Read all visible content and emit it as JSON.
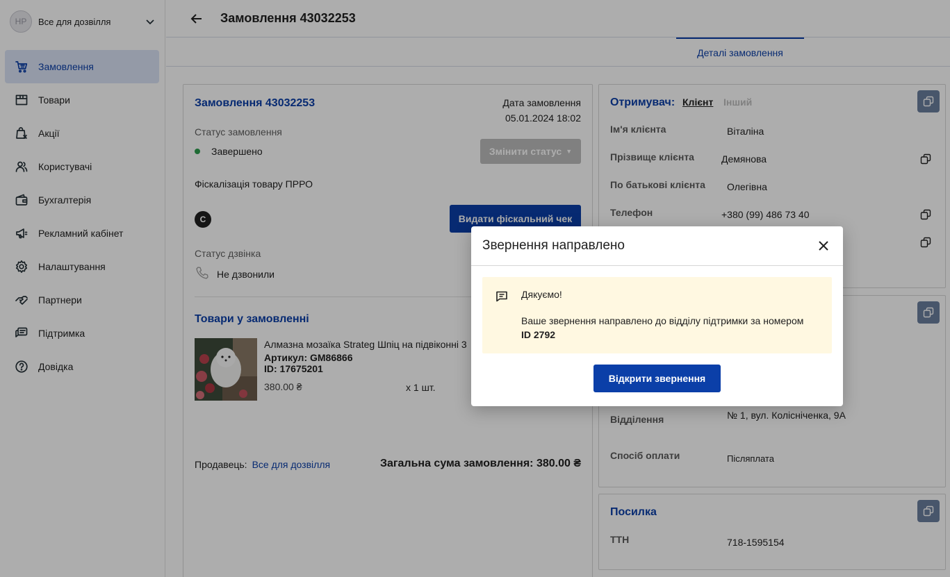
{
  "shop": {
    "avatar": "HP",
    "name": "Все для дозвілля"
  },
  "nav": [
    {
      "label": "Замовлення",
      "icon": "cart-icon"
    },
    {
      "label": "Товари",
      "icon": "box-icon"
    },
    {
      "label": "Акції",
      "icon": "promo-bag-icon"
    },
    {
      "label": "Користувачі",
      "icon": "users-icon"
    },
    {
      "label": "Бухгалтерія",
      "icon": "wallet-icon"
    },
    {
      "label": "Рекламний кабінет",
      "icon": "megaphone-icon"
    },
    {
      "label": "Налаштування",
      "icon": "gear-icon"
    },
    {
      "label": "Партнери",
      "icon": "handshake-icon"
    },
    {
      "label": "Підтримка",
      "icon": "chat-icon"
    },
    {
      "label": "Довідка",
      "icon": "help-icon"
    }
  ],
  "header": {
    "title": "Замовлення 43032253"
  },
  "tabs": {
    "active": "Деталі замовлення"
  },
  "order": {
    "title": "Замовлення 43032253",
    "date_label": "Дата замовлення",
    "date_value": "05.01.2024 18:02",
    "status_label": "Статус замовлення",
    "status_value": "Завершено",
    "change_status": "Змінити статус",
    "fiscal_label": "Фіскалізація товару ПРРО",
    "fiscal_badge": "C",
    "fiscal_button": "Видати фіскальний чек",
    "call_status_label": "Статус дзвінка",
    "call_status_value": "Не дзвонили",
    "items_title": "Товари у замовленні",
    "item": {
      "name": "Алмазна мозаїка Strateg Шпіц на підвіконні 3",
      "article": "Артикул: GM86866",
      "id": "ID: 17675201",
      "price": "380.00 ₴",
      "qty": "x 1 шт."
    },
    "seller_label": "Продавець:",
    "seller_name": "Все для дозвілля",
    "total": "Загальна сума замовлення: 380.00 ₴"
  },
  "recipient": {
    "title": "Отримувач:",
    "tab_client": "Клієнт",
    "tab_other": "Інший",
    "fields": [
      {
        "label": "Ім'я клієнта",
        "value": "Віталіна"
      },
      {
        "label": "Прізвище клієнта",
        "value": "Демянова"
      },
      {
        "label": "По батькові клієнта",
        "value": "Олегівна"
      },
      {
        "label": "Телефон",
        "value": "+380 (99) 486 73 40"
      }
    ]
  },
  "delivery": {
    "branch_label": "Відділення",
    "branch_value": "№ 1, вул. Колісніченка, 9А",
    "payment_label": "Спосіб оплати",
    "payment_value": "Післяплата"
  },
  "parcel": {
    "title": "Посилка",
    "ttn_label": "ТТН",
    "ttn_value": "718-1595154"
  },
  "modal": {
    "title": "Звернення направлено",
    "thanks": "Дякуємо!",
    "message": "Ваше звернення направлено до відділу підтримки за номером",
    "ticket_id": "ID 2792",
    "button": "Відкрити звернення"
  }
}
